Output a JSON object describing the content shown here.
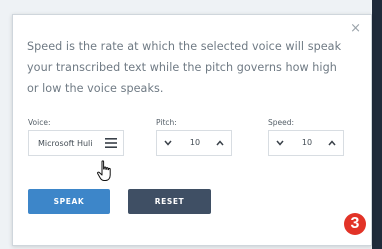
{
  "modal": {
    "close_glyph": "×",
    "description": "Speed is the rate at which the selected voice will speak your transcribed text while the pitch governs how high or low the voice speaks."
  },
  "voice": {
    "label": "Voice:",
    "selected": "Microsoft Huli"
  },
  "pitch": {
    "label": "Pitch:",
    "value": "10"
  },
  "speed": {
    "label": "Speed:",
    "value": "10"
  },
  "buttons": {
    "speak": "SPEAK",
    "reset": "RESET"
  },
  "badge": {
    "number": "3"
  },
  "colors": {
    "speak_button": "#3d86c9",
    "reset_button": "#3f4f64",
    "badge": "#e23327",
    "description_text": "#6f7a84"
  },
  "icons": {
    "close": "close-icon",
    "voice_menu": "menu-icon",
    "cursor": "hand-pointer-icon",
    "decrement": "chevron-down-icon",
    "increment": "chevron-up-icon"
  }
}
